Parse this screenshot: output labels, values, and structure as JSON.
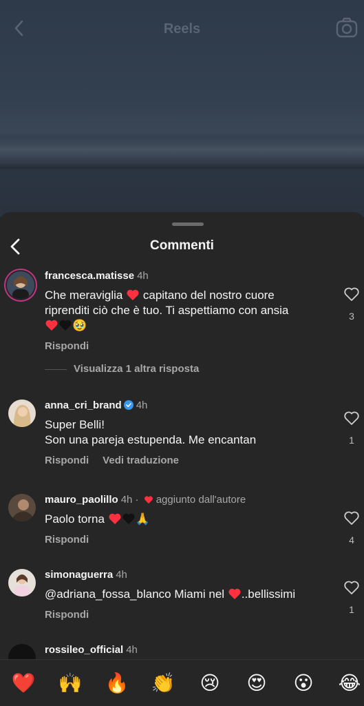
{
  "header": {
    "title": "Reels"
  },
  "sheet": {
    "title": "Commenti"
  },
  "comments": [
    {
      "username": "francesca.matisse",
      "time": "4h",
      "text_line1a": "Che meraviglia",
      "text_line1b": "capitano del nostro cuore",
      "text_line2": "riprenditi ciò che è tuo. Ti aspettiamo con ansia",
      "emoji_tail": "🥹",
      "reply_label": "Rispondi",
      "likes": "3",
      "more_replies": "Visualizza 1 altra risposta"
    },
    {
      "username": "anna_cri_brand",
      "time": "4h",
      "text_line1": "Super Belli!",
      "text_line2": "Son una pareja estupenda. Me encantan",
      "reply_label": "Rispondi",
      "translate_label": "Vedi traduzione",
      "likes": "1"
    },
    {
      "username": "mauro_paolillo",
      "time": "4h",
      "author_note": "aggiunto dall'autore",
      "text": "Paolo torna",
      "emoji_tail": "🙏",
      "reply_label": "Rispondi",
      "likes": "4"
    },
    {
      "username": "simonaguerra",
      "time": "4h",
      "text_a": "@adriana_fossa_blanco Miami nel",
      "text_b": "..bellissimi",
      "reply_label": "Rispondi",
      "likes": "1"
    },
    {
      "username": "rossileo_official",
      "time": "4h"
    }
  ],
  "reactions": [
    "❤️",
    "🙌",
    "🔥",
    "👏",
    "😢",
    "😍",
    "😮",
    "😂"
  ],
  "colors": {
    "heart": "#ff3040",
    "verified": "#3897f0",
    "accent_ring": "#c13584"
  }
}
